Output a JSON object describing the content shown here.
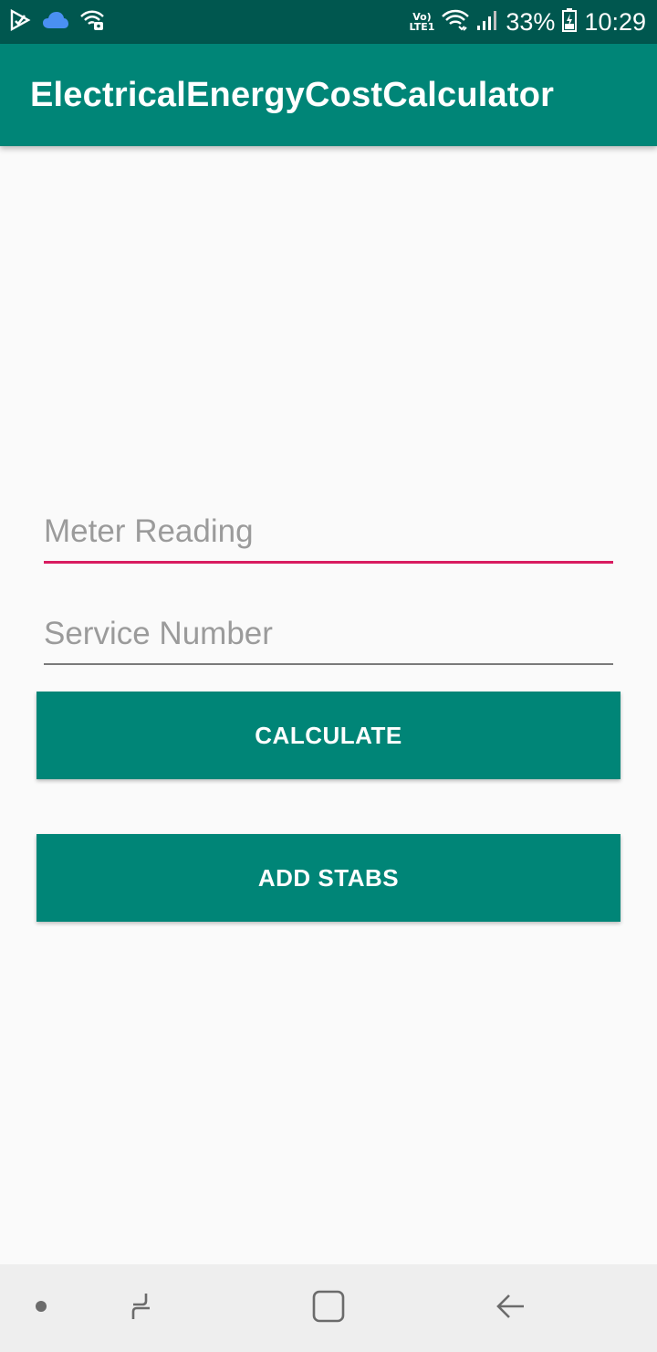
{
  "status_bar": {
    "icons_left": [
      "play-store-icon",
      "cloud-icon",
      "wifi-secure-icon"
    ],
    "lte_line1": "Vo)",
    "lte_line2": "LTE1",
    "battery": "33%",
    "time": "10:29"
  },
  "app_bar": {
    "title": "ElectricalEnergyCostCalculator"
  },
  "form": {
    "meter_reading": {
      "value": "",
      "placeholder": "Meter Reading"
    },
    "service_number": {
      "value": "",
      "placeholder": "Service Number"
    }
  },
  "buttons": {
    "calculate": "CALCULATE",
    "add_stabs": "ADD STABS"
  },
  "navigation": {
    "items": [
      "dot-icon",
      "recents-icon",
      "home-icon",
      "back-icon"
    ]
  },
  "colors": {
    "status_bar": "#00574f",
    "primary": "#008577",
    "accent": "#d81b60",
    "background": "#fafafa",
    "nav_bar": "#eeeeee"
  }
}
